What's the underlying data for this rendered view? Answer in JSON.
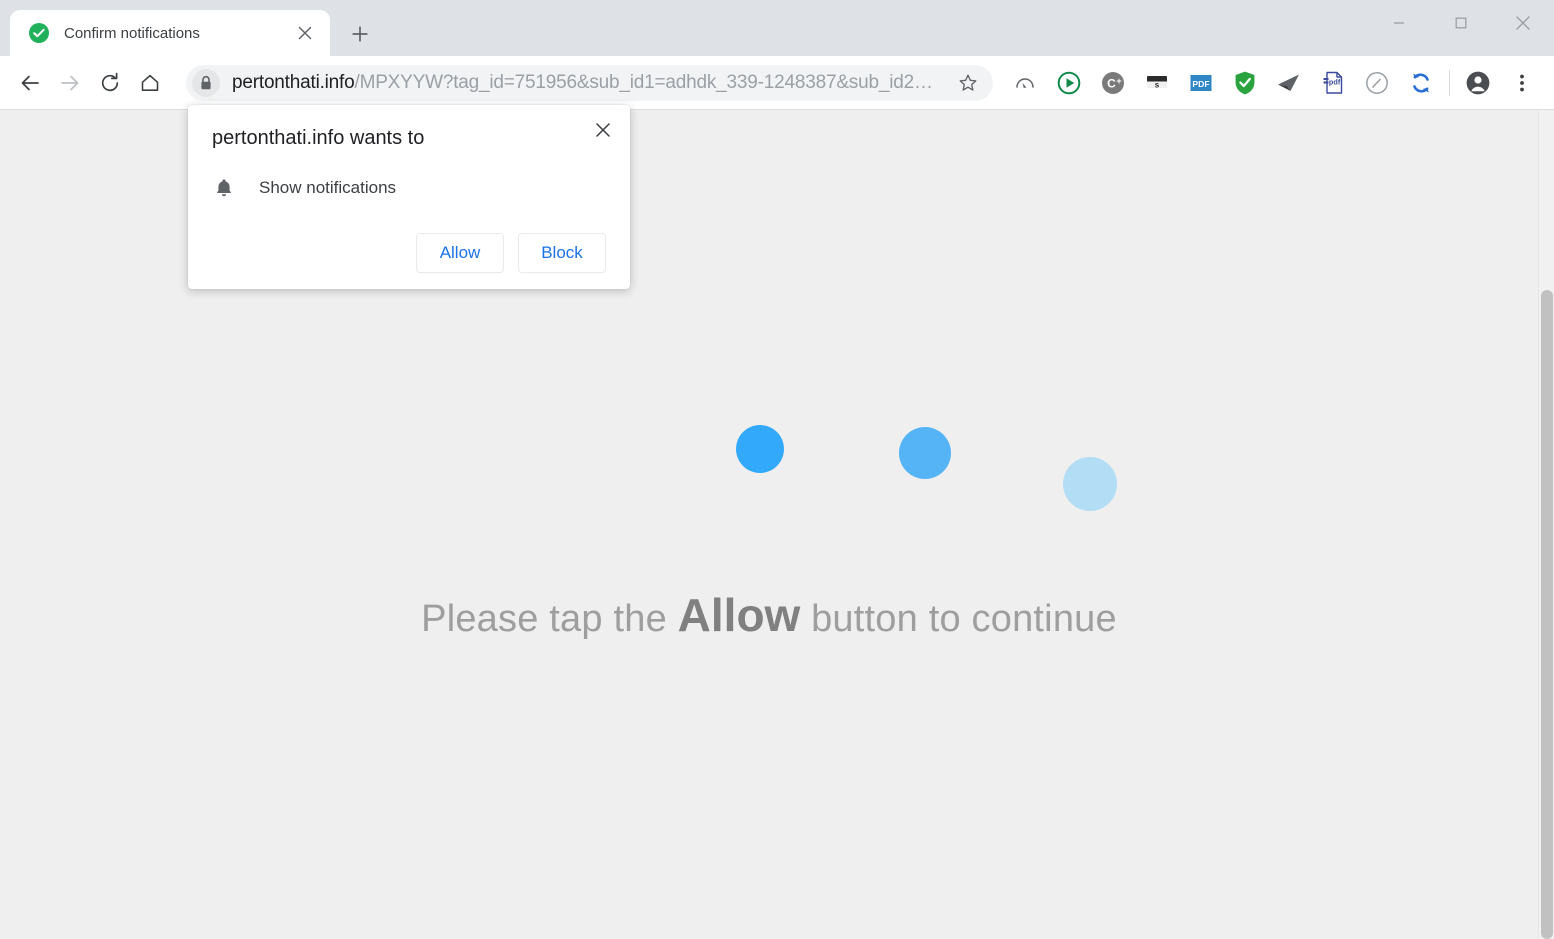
{
  "window": {
    "controls": [
      {
        "name": "minimize",
        "glyph": "—"
      },
      {
        "name": "maximize",
        "glyph": "□"
      },
      {
        "name": "close",
        "glyph": "✕"
      }
    ]
  },
  "tabstrip": {
    "tab_title": "Confirm notifications",
    "tab_favicon": "green-check-circle-icon",
    "close_glyph": "✕",
    "newtab_glyph": "+"
  },
  "toolbar": {
    "back_icon": "back-arrow-icon",
    "forward_icon": "forward-arrow-icon",
    "reload_icon": "reload-icon",
    "home_icon": "home-icon",
    "lock_icon": "lock-icon",
    "url_host": "pertonthati.info",
    "url_path": "/MPXYYW?tag_id=751956&sub_id1=adhdk_339-1248387&sub_id2…",
    "star_icon": "bookmark-star-icon",
    "extensions": [
      {
        "name": "speedometer-cursor-extension-icon",
        "label": ""
      },
      {
        "name": "green-play-extension-icon",
        "label": ""
      },
      {
        "name": "c-plus-extension-icon",
        "label": "C+"
      },
      {
        "name": "s-badge-extension-icon",
        "label": "s"
      },
      {
        "name": "pdf-badge-extension-icon",
        "label": "PDF"
      },
      {
        "name": "green-shield-check-extension-icon",
        "label": ""
      },
      {
        "name": "paper-plane-extension-icon",
        "label": ""
      },
      {
        "name": "pdf-document-extension-icon",
        "label": "pdf"
      },
      {
        "name": "gauge-extension-icon",
        "label": ""
      },
      {
        "name": "sync-arrows-extension-icon",
        "label": ""
      }
    ],
    "profile_icon": "profile-avatar-icon",
    "menu_icon": "three-dot-menu-icon"
  },
  "permission_dialog": {
    "title": "pertonthati.info wants to",
    "close_glyph": "✕",
    "bell_icon": "bell-icon",
    "request_label": "Show notifications",
    "allow_label": "Allow",
    "block_label": "Block",
    "accent_color": "#1a73e8"
  },
  "page": {
    "background_color": "#efefef",
    "loader_dots": [
      {
        "color": "#33a9fb",
        "size": 48
      },
      {
        "color": "#4cb0f5",
        "size": 52
      },
      {
        "color": "#b3ddf5",
        "size": 54
      }
    ],
    "tagline_prefix": "Please tap the ",
    "tagline_emphasis": "Allow",
    "tagline_suffix": " button to continue",
    "text_color": "#9e9e9e"
  }
}
